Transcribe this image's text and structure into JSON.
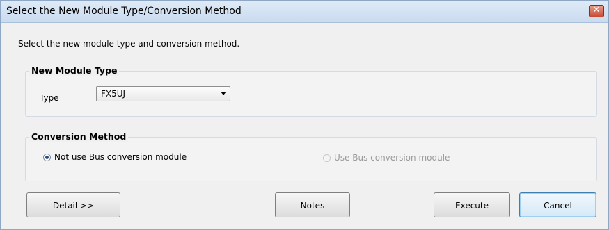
{
  "window": {
    "title": "Select the New Module Type/Conversion Method"
  },
  "instruction": "Select the new module type and conversion method.",
  "new_module_type": {
    "title": "New Module Type",
    "type_label": "Type",
    "type_value": "FX5UJ"
  },
  "conversion_method": {
    "title": "Conversion Method",
    "options": [
      {
        "label": "Not use Bus conversion module",
        "selected": true,
        "enabled": true
      },
      {
        "label": "Use Bus conversion module",
        "selected": false,
        "enabled": false
      }
    ]
  },
  "buttons": {
    "detail": "Detail >>",
    "notes": "Notes",
    "execute": "Execute",
    "cancel": "Cancel"
  },
  "icons": {
    "close": "close-icon",
    "dropdown": "chevron-down-icon"
  }
}
